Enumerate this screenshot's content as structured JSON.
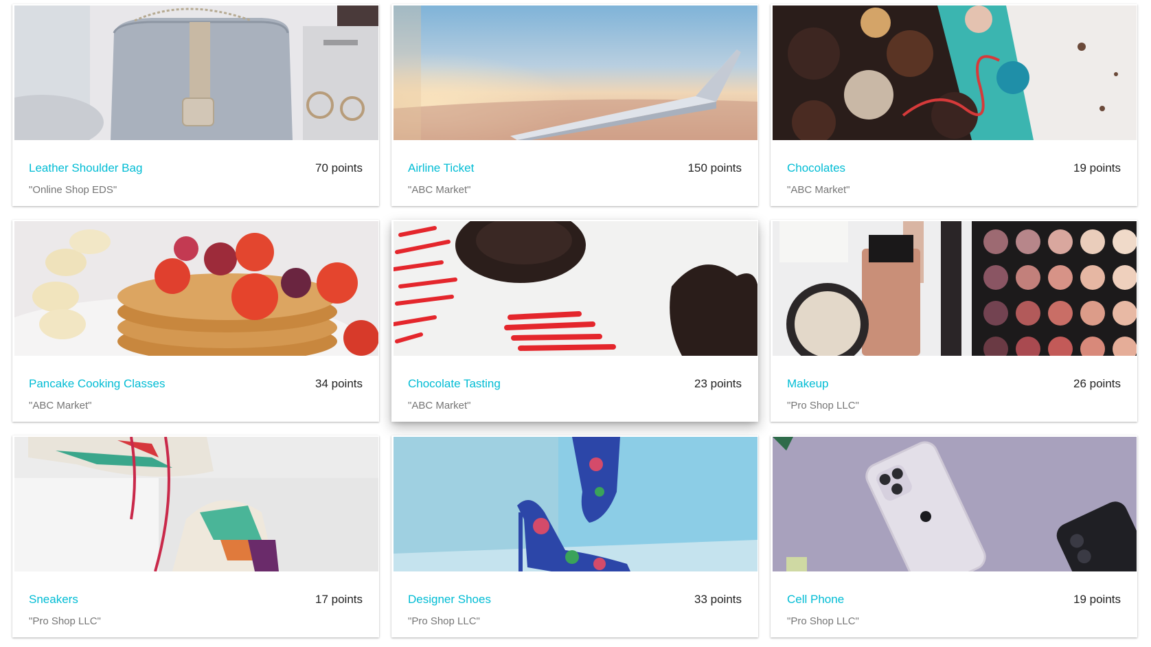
{
  "rewards": [
    {
      "title": "Leather Shoulder Bag",
      "points": "70 points",
      "seller": "\"Online Shop EDS\""
    },
    {
      "title": "Airline Ticket",
      "points": "150 points",
      "seller": "\"ABC Market\""
    },
    {
      "title": "Chocolates",
      "points": "19 points",
      "seller": "\"ABC Market\""
    },
    {
      "title": "Pancake Cooking Classes",
      "points": "34 points",
      "seller": "\"ABC Market\""
    },
    {
      "title": "Chocolate Tasting",
      "points": "23 points",
      "seller": "\"ABC Market\""
    },
    {
      "title": "Makeup",
      "points": "26 points",
      "seller": "\"Pro Shop LLC\""
    },
    {
      "title": "Sneakers",
      "points": "17 points",
      "seller": "\"Pro Shop LLC\""
    },
    {
      "title": "Designer Shoes",
      "points": "33 points",
      "seller": "\"Pro Shop LLC\""
    },
    {
      "title": "Cell Phone",
      "points": "19 points",
      "seller": "\"Pro Shop LLC\""
    }
  ],
  "images": {
    "bag": "bag-photo",
    "wing": "airplane-wing-photo",
    "chocolates": "chocolates-box-photo",
    "pancakes": "pancakes-photo",
    "tasting": "chocolate-tasting-photo",
    "makeup": "makeup-photo",
    "sneakers": "sneakers-photo",
    "shoes": "designer-shoes-photo",
    "phone": "cell-phone-photo"
  },
  "theme": {
    "accent": "#00bcd4",
    "text": "#212121",
    "muted": "#757575"
  }
}
